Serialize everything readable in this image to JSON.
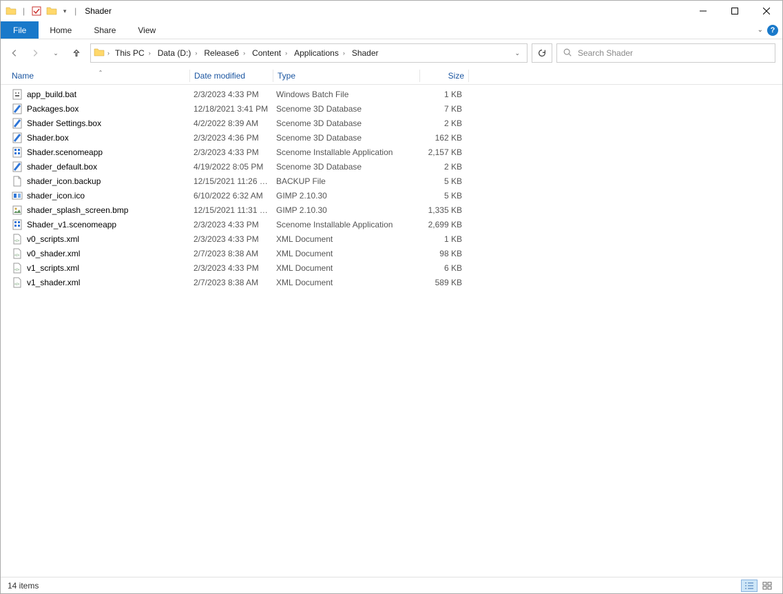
{
  "window": {
    "title": "Shader"
  },
  "ribbon": {
    "file": "File",
    "tabs": [
      "Home",
      "Share",
      "View"
    ]
  },
  "breadcrumbs": [
    "This PC",
    "Data (D:)",
    "Release6",
    "Content",
    "Applications",
    "Shader"
  ],
  "search": {
    "placeholder": "Search Shader"
  },
  "columns": {
    "name": "Name",
    "date": "Date modified",
    "type": "Type",
    "size": "Size"
  },
  "files": [
    {
      "icon": "bat",
      "name": "app_build.bat",
      "date": "2/3/2023 4:33 PM",
      "type": "Windows Batch File",
      "size": "1 KB"
    },
    {
      "icon": "box",
      "name": "Packages.box",
      "date": "12/18/2021 3:41 PM",
      "type": "Scenome 3D Database",
      "size": "7 KB"
    },
    {
      "icon": "box",
      "name": "Shader Settings.box",
      "date": "4/2/2022 8:39 AM",
      "type": "Scenome 3D Database",
      "size": "2 KB"
    },
    {
      "icon": "box",
      "name": "Shader.box",
      "date": "2/3/2023 4:36 PM",
      "type": "Scenome 3D Database",
      "size": "162 KB"
    },
    {
      "icon": "app",
      "name": "Shader.scenomeapp",
      "date": "2/3/2023 4:33 PM",
      "type": "Scenome Installable Application",
      "size": "2,157 KB"
    },
    {
      "icon": "box",
      "name": "shader_default.box",
      "date": "4/19/2022 8:05 PM",
      "type": "Scenome 3D Database",
      "size": "2 KB"
    },
    {
      "icon": "blank",
      "name": "shader_icon.backup",
      "date": "12/15/2021 11:26 …",
      "type": "BACKUP File",
      "size": "5 KB"
    },
    {
      "icon": "ico",
      "name": "shader_icon.ico",
      "date": "6/10/2022 6:32 AM",
      "type": "GIMP 2.10.30",
      "size": "5 KB"
    },
    {
      "icon": "bmp",
      "name": "shader_splash_screen.bmp",
      "date": "12/15/2021 11:31 …",
      "type": "GIMP 2.10.30",
      "size": "1,335 KB"
    },
    {
      "icon": "app",
      "name": "Shader_v1.scenomeapp",
      "date": "2/3/2023 4:33 PM",
      "type": "Scenome Installable Application",
      "size": "2,699 KB"
    },
    {
      "icon": "xml",
      "name": "v0_scripts.xml",
      "date": "2/3/2023 4:33 PM",
      "type": "XML Document",
      "size": "1 KB"
    },
    {
      "icon": "xml",
      "name": "v0_shader.xml",
      "date": "2/7/2023 8:38 AM",
      "type": "XML Document",
      "size": "98 KB"
    },
    {
      "icon": "xml",
      "name": "v1_scripts.xml",
      "date": "2/3/2023 4:33 PM",
      "type": "XML Document",
      "size": "6 KB"
    },
    {
      "icon": "xml",
      "name": "v1_shader.xml",
      "date": "2/7/2023 8:38 AM",
      "type": "XML Document",
      "size": "589 KB"
    }
  ],
  "status": {
    "text": "14 items"
  }
}
